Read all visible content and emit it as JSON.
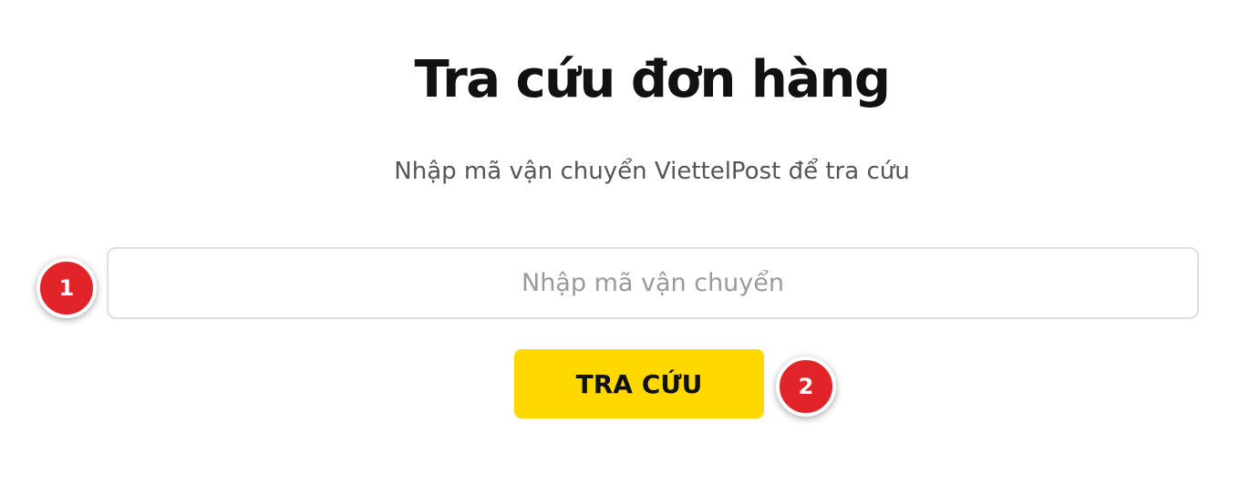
{
  "page": {
    "title": "Tra cứu đơn hàng",
    "subtitle": "Nhập mã vận chuyển ViettelPost để tra cứu"
  },
  "search": {
    "placeholder": "Nhập mã vận chuyển",
    "value": "",
    "button_label": "TRA CỨU"
  },
  "markers": [
    {
      "label": "1"
    },
    {
      "label": "2"
    }
  ],
  "colors": {
    "accent": "#ffd800",
    "marker": "#e0242a"
  }
}
